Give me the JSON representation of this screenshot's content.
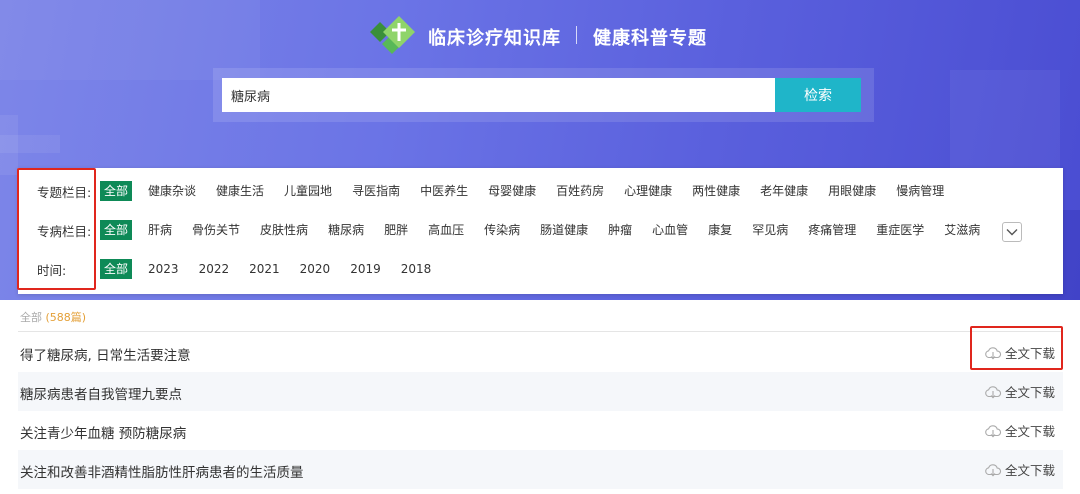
{
  "header": {
    "brand_primary": "临床诊疗知识库",
    "brand_secondary": "健康科普专题",
    "logo_icon": "medical-cross-diamond-logo",
    "colors": {
      "hero_gradient_start": "#7d86e8",
      "hero_gradient_end": "#4a4dd2",
      "logo_green": "#4cae4c"
    }
  },
  "search": {
    "value": "糖尿病",
    "button_label": "检索",
    "button_color": "#1fb5c9"
  },
  "filters": {
    "active_chip_color": "#0e8a57",
    "topic": {
      "label": "专题栏目:",
      "options": [
        "全部",
        "健康杂谈",
        "健康生活",
        "儿童园地",
        "寻医指南",
        "中医养生",
        "母婴健康",
        "百姓药房",
        "心理健康",
        "两性健康",
        "老年健康",
        "用眼健康",
        "慢病管理"
      ]
    },
    "disease": {
      "label": "专病栏目:",
      "options": [
        "全部",
        "肝病",
        "骨伤关节",
        "皮肤性病",
        "糖尿病",
        "肥胖",
        "高血压",
        "传染病",
        "肠道健康",
        "肿瘤",
        "心血管",
        "康复",
        "罕见病",
        "疼痛管理",
        "重症医学",
        "艾滋病"
      ]
    },
    "time": {
      "label": "时间:",
      "options": [
        "全部",
        "2023",
        "2022",
        "2021",
        "2020",
        "2019",
        "2018"
      ]
    },
    "expand_icon": "chevron-down-icon"
  },
  "results": {
    "scope_label": "全部",
    "count_text": "(588篇)",
    "items": [
      {
        "title": "得了糖尿病, 日常生活要注意",
        "action": "全文下载"
      },
      {
        "title": "糖尿病患者自我管理九要点",
        "action": "全文下载"
      },
      {
        "title": "关注青少年血糖 预防糖尿病",
        "action": "全文下载"
      },
      {
        "title": "关注和改善非酒精性脂肪性肝病患者的生活质量",
        "action": "全文下载"
      }
    ],
    "download_icon": "cloud-download-icon"
  },
  "annotation_color": "#e0261d"
}
